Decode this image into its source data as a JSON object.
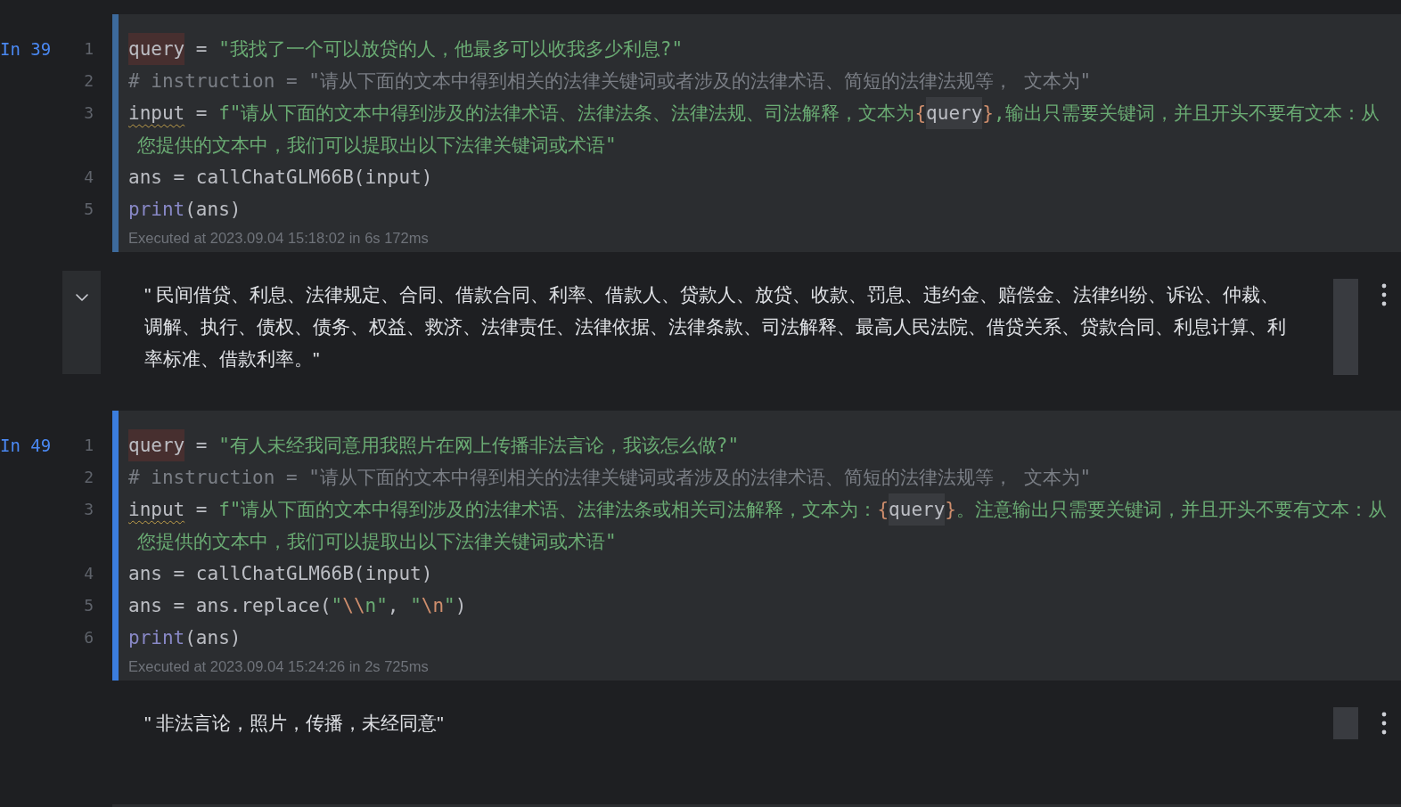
{
  "cells": [
    {
      "prompt": "In 39",
      "selected": false,
      "lines": [
        {
          "number": "1",
          "tokens": [
            {
              "kind": "highlighted",
              "text": "query"
            },
            {
              "kind": "plain",
              "text": " = "
            },
            {
              "kind": "string",
              "text": "\"我找了一个可以放贷的人，他最多可以收我多少利息?\""
            }
          ]
        },
        {
          "number": "2",
          "tokens": [
            {
              "kind": "comment",
              "text": "# instruction = \"请从下面的文本中得到相关的法律关键词或者涉及的法律术语、简短的法律法规等， 文本为\""
            }
          ]
        },
        {
          "number": "3",
          "tokens": [
            {
              "kind": "shadowed",
              "text": "input"
            },
            {
              "kind": "plain",
              "text": " = "
            },
            {
              "kind": "string",
              "text": "f\"请从下面的文本中得到涉及的法律术语、法律法条、法律法规、司法解释，文本为"
            },
            {
              "kind": "escape",
              "text": "{"
            },
            {
              "kind": "interpolated",
              "text": "query"
            },
            {
              "kind": "escape",
              "text": "}"
            },
            {
              "kind": "string",
              "text": ",输出只需要关键词，并且开头不要有文本：从"
            }
          ],
          "continuation": [
            {
              "kind": "string",
              "text": "您提供的文本中，我们可以提取出以下法律关键词或术语\""
            }
          ]
        },
        {
          "number": "4",
          "tokens": [
            {
              "kind": "plain",
              "text": "ans = callChatGLM66B(input)"
            }
          ]
        },
        {
          "number": "5",
          "tokens": [
            {
              "kind": "builtin",
              "text": "print"
            },
            {
              "kind": "plain",
              "text": "(ans)"
            }
          ]
        }
      ],
      "status": "Executed at 2023.09.04 15:18:02 in 6s 172ms",
      "output": {
        "text": "\" 民间借贷、利息、法律规定、合同、借款合同、利率、借款人、贷款人、放贷、收款、罚息、违约金、赔偿金、法律纠纷、诉讼、仲裁、调解、执行、债权、债务、权益、救济、法律责任、法律依据、法律条款、司法解释、最高人民法院、借贷关系、贷款合同、利息计算、利率标准、借款利率。\"",
        "collapse_toggle": true
      }
    },
    {
      "prompt": "In 49",
      "selected": true,
      "lines": [
        {
          "number": "1",
          "tokens": [
            {
              "kind": "highlighted",
              "text": "query"
            },
            {
              "kind": "plain",
              "text": " = "
            },
            {
              "kind": "string",
              "text": "\"有人未经我同意用我照片在网上传播非法言论，我该怎么做?\""
            }
          ]
        },
        {
          "number": "2",
          "tokens": [
            {
              "kind": "comment",
              "text": "# instruction = \"请从下面的文本中得到相关的法律关键词或者涉及的法律术语、简短的法律法规等， 文本为\""
            }
          ]
        },
        {
          "number": "3",
          "tokens": [
            {
              "kind": "shadowed",
              "text": "input"
            },
            {
              "kind": "plain",
              "text": " = "
            },
            {
              "kind": "string",
              "text": "f\"请从下面的文本中得到涉及的法律术语、法律法条或相关司法解释，文本为："
            },
            {
              "kind": "escape",
              "text": "{"
            },
            {
              "kind": "interpolated",
              "text": "query"
            },
            {
              "kind": "escape",
              "text": "}"
            },
            {
              "kind": "string",
              "text": "。注意输出只需要关键词，并且开头不要有文本：从"
            }
          ],
          "continuation": [
            {
              "kind": "string",
              "text": "您提供的文本中，我们可以提取出以下法律关键词或术语\""
            }
          ]
        },
        {
          "number": "4",
          "tokens": [
            {
              "kind": "plain",
              "text": "ans = callChatGLM66B(input)"
            }
          ]
        },
        {
          "number": "5",
          "tokens": [
            {
              "kind": "plain",
              "text": "ans = ans.replace("
            },
            {
              "kind": "string",
              "text": "\""
            },
            {
              "kind": "escape",
              "text": "\\\\"
            },
            {
              "kind": "string",
              "text": "n\""
            },
            {
              "kind": "plain",
              "text": ", "
            },
            {
              "kind": "string",
              "text": "\""
            },
            {
              "kind": "escape",
              "text": "\\n"
            },
            {
              "kind": "string",
              "text": "\""
            },
            {
              "kind": "plain",
              "text": ")"
            }
          ]
        },
        {
          "number": "6",
          "tokens": [
            {
              "kind": "builtin",
              "text": "print"
            },
            {
              "kind": "plain",
              "text": "(ans)"
            }
          ]
        }
      ],
      "status": "Executed at 2023.09.04 15:24:26 in 2s 725ms",
      "output": {
        "text": "\" 非法言论，照片，传播，未经同意\"",
        "collapse_toggle": false
      }
    }
  ]
}
